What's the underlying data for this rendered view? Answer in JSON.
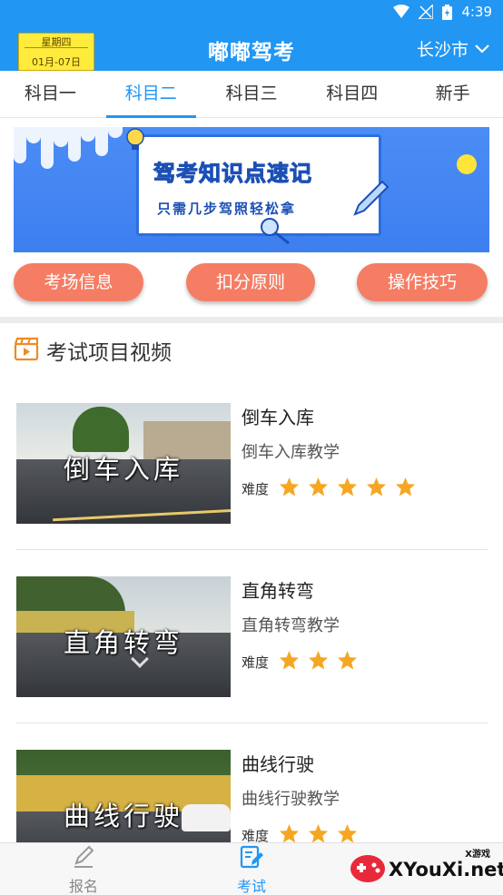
{
  "status_bar": {
    "time": "4:39",
    "background": "#2196f3"
  },
  "header": {
    "date_badge": {
      "weekday": "星期四",
      "range": "01月-07日"
    },
    "title": "嘟嘟驾考",
    "city": "长沙市",
    "city_icon": "chevron-down-icon"
  },
  "tabs": [
    {
      "label": "科目一",
      "active": false
    },
    {
      "label": "科目二",
      "active": true
    },
    {
      "label": "科目三",
      "active": false
    },
    {
      "label": "科目四",
      "active": false
    },
    {
      "label": "新手",
      "active": false
    }
  ],
  "banner": {
    "title": "驾考知识点速记",
    "subtitle": "只需几步驾照轻松拿"
  },
  "quick_buttons": [
    "考场信息",
    "扣分原则",
    "操作技巧"
  ],
  "section": {
    "title": "考试项目视频",
    "icon": "video-clapper-icon"
  },
  "videos": [
    {
      "overlay": "倒车入库",
      "title": "倒车入库",
      "subtitle": "倒车入库教学",
      "difficulty_label": "难度",
      "difficulty": 5
    },
    {
      "overlay": "直角转弯",
      "title": "直角转弯",
      "subtitle": "直角转弯教学",
      "difficulty_label": "难度",
      "difficulty": 3
    },
    {
      "overlay": "曲线行驶",
      "title": "曲线行驶",
      "subtitle": "曲线行驶教学",
      "difficulty_label": "难度",
      "difficulty": 3
    }
  ],
  "bottom_nav": [
    {
      "label": "报名",
      "icon": "pen-icon",
      "active": false
    },
    {
      "label": "考试",
      "icon": "exam-edit-icon",
      "active": true
    }
  ],
  "watermark": {
    "site": "XYouXi.net",
    "small": "X游戏"
  },
  "colors": {
    "accent": "#2196f3",
    "pill": "#f47d63",
    "star": "#f5a623",
    "badge": "#ffeb3b"
  }
}
